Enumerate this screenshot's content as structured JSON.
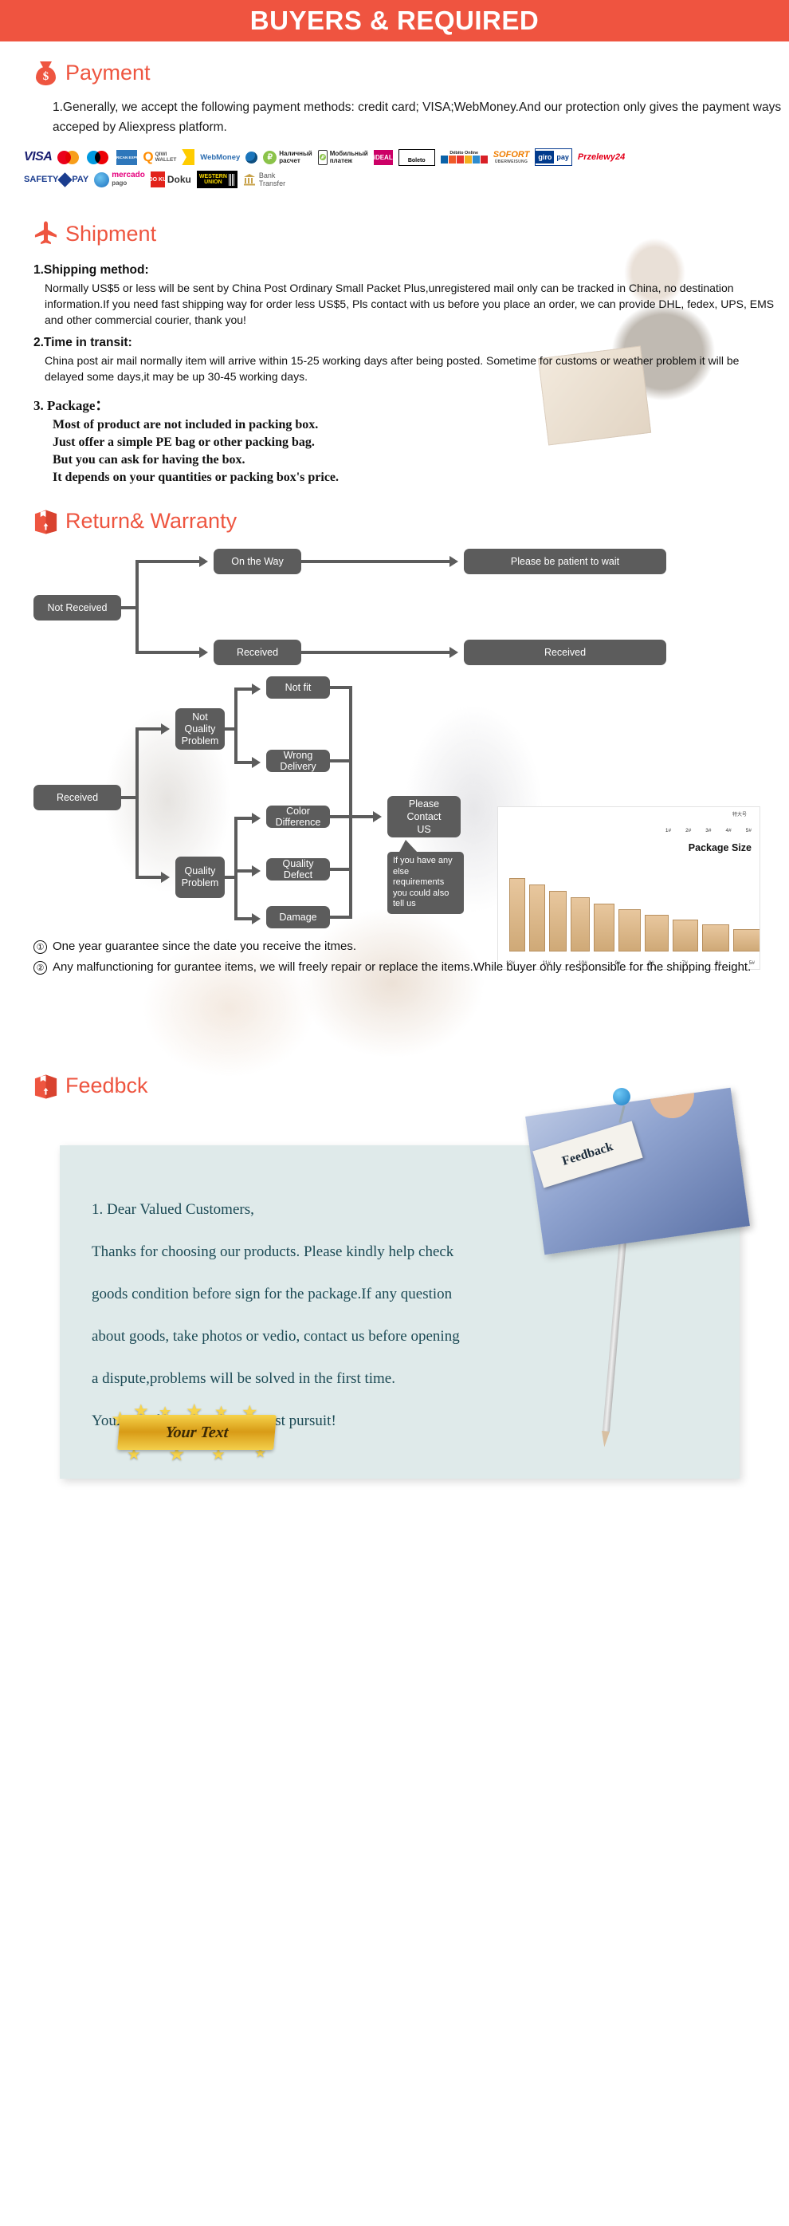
{
  "banner": {
    "title": "BUYERS & REQUIRED",
    "color": "#ef5440"
  },
  "theme": {
    "accent": "#ee5540",
    "node_gray": "#5c5c5c",
    "letter_bg": "#dfeaea",
    "letter_text": "#1c4a55"
  },
  "payment": {
    "icon": "money-bag-icon",
    "title": "Payment",
    "body": "1.Generally, we accept the following payment methods: credit card; VISA;WebMoney.And our protection only gives the payment ways acceped by Aliexpress platform.",
    "logos_row1": [
      "VISA",
      "MasterCard",
      "Maestro",
      "American Express",
      "QIWI WALLET",
      "Yandex Money",
      "WebMoney",
      "Наличный расчет",
      "Мобильный платеж",
      "iDEAL",
      "Boleto",
      "Débito Online",
      "SOFORT ÜBERWEISUNG",
      "giropay",
      "Przelewy24"
    ],
    "logos_row2": [
      "SAFETY PAY",
      "mercado pago",
      "Doku",
      "WESTERN UNION",
      "Bank Transfer"
    ],
    "logo_text": {
      "visa": "VISA",
      "mastercard": "MasterCard",
      "maestro": "Maestro",
      "amex": "AMERICAN EXPRESS",
      "qiwi_q": "Q",
      "qiwi_name": "QIWI",
      "qiwi_wallet": "WALLET",
      "webmoney": "WebMoney",
      "nalichny_1": "Наличный",
      "nalichny_2": "расчет",
      "mobile_1": "Мобильный",
      "mobile_2": "платеж",
      "ideal": "iDEAL",
      "boleto": "Boleto",
      "debito": "Débito Online",
      "sofort_1": "SOFORT",
      "sofort_2": "ÜBERWEISUNG",
      "giro_a": "giro",
      "giro_b": "pay",
      "przelewy": "Przelewy24",
      "safety": "SAFETY",
      "pay": "PAY",
      "mercado": "mercado",
      "pago": "pago",
      "doku_sq": "DO KU",
      "doku": "Doku",
      "wu_1": "WESTERN",
      "wu_2": "UNION",
      "bank_1": "Bank",
      "bank_2": "Transfer"
    }
  },
  "shipment": {
    "icon": "airplane-icon",
    "title": "Shipment",
    "item1_head": "1.Shipping method:",
    "item1_body": "Normally US$5 or less will be sent by China Post Ordinary Small Packet Plus,unregistered mail only can be tracked in China, no destination information.If you need fast shipping way for order less US$5, Pls contact with us before you place an order, we can provide DHL, fedex, UPS, EMS and other commercial courier, thank you!",
    "item2_head": "2.Time in transit:",
    "item2_body": "China post air mail normally item will arrive within 15-25 working days after being posted. Sometime for customs or weather problem it will be delayed some days,it may be up 30-45 working days.",
    "item3_head": "3. Package：",
    "item3_body": "Most of product are not included in packing box.\nJust offer a simple PE bag or other packing bag.\nBut you can ask for having the box.\nIt depends on your quantities or packing box's price.",
    "package_size_label": "Package Size",
    "package_top_label": "特大号",
    "package_box_labels": [
      "1#",
      "2#",
      "3#",
      "4#",
      "5#"
    ],
    "package_ticks": [
      "12#",
      "11#",
      "10#",
      "9#",
      "8#",
      "7#",
      "6#",
      "5#"
    ]
  },
  "return_warranty": {
    "icon": "return-box-icon",
    "title": "Return& Warranty",
    "flow1": {
      "root": "Not Received",
      "branch_top": "On the Way",
      "branch_top_result": "Please be patient to wait",
      "branch_bottom": "Received",
      "branch_bottom_result": "Received"
    },
    "flow2": {
      "root": "Received",
      "group_a": "Not\nQuality\nProblem",
      "group_b": "Quality\nProblem",
      "leaf_a1": "Not fit",
      "leaf_a2": "Wrong Delivery",
      "leaf_b1": "Color Difference",
      "leaf_b2": "Quality Defect",
      "leaf_b3": "Damage",
      "result": "Please\nContact\nUS",
      "callout": "If you have any else requirements you could also tell us"
    },
    "guarantee": [
      {
        "num": "①",
        "text": "One year guarantee since the date you receive the itmes."
      },
      {
        "num": "②",
        "text": "Any malfunctioning for gurantee items, we will freely repair or replace the items.While buyer only responsible for the shipping freight."
      }
    ]
  },
  "feedback": {
    "icon": "feedback-box-icon",
    "title": "Feedbck",
    "photo_card_text": "Feedback",
    "letter": [
      "1. Dear Valued Customers,",
      "Thanks for choosing our products. Please kindly help check",
      "goods condition before sign for the package.If any question",
      "about goods, take photos or vedio, contact us before opening",
      " a dispute,problems will be solved in the first time.",
      "Your Satisfaction is our greatest pursuit!"
    ],
    "ribbon_text": "Your Text"
  }
}
